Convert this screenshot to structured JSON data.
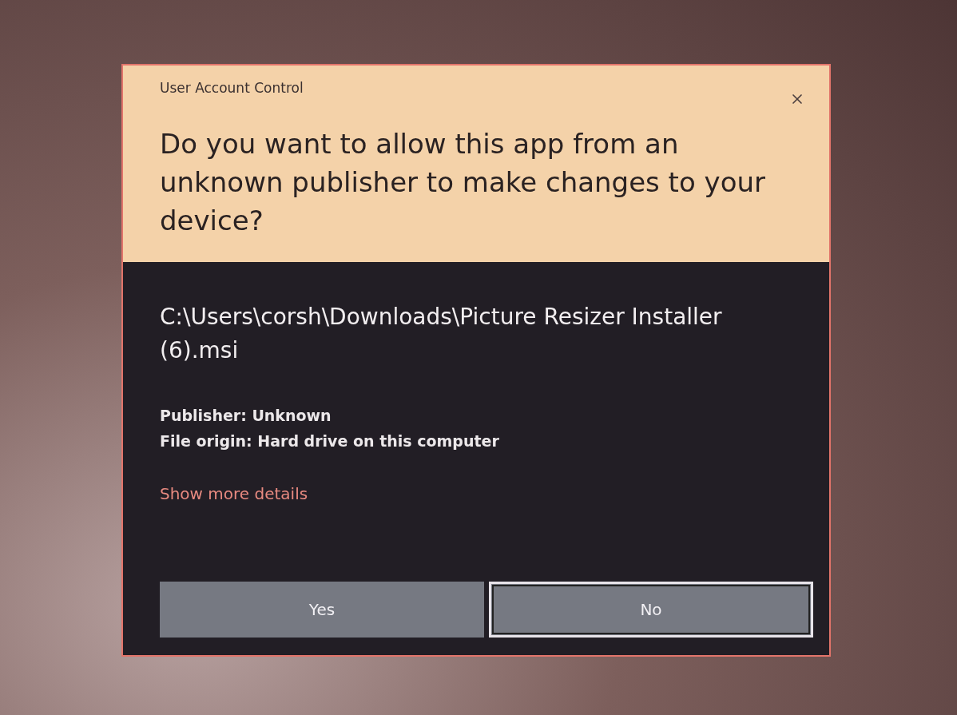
{
  "dialog": {
    "title": "User Account Control",
    "question": "Do you want to allow this app from an unknown publisher to make changes to your device?",
    "program_path": "C:\\Users\\corsh\\Downloads\\Picture Resizer Installer (6).msi",
    "details": [
      "Publisher: Unknown",
      "File origin: Hard drive on this computer"
    ],
    "more_link": "Show more details",
    "buttons": [
      {
        "label": "Yes",
        "selected": false
      },
      {
        "label": "No",
        "selected": true
      }
    ]
  }
}
